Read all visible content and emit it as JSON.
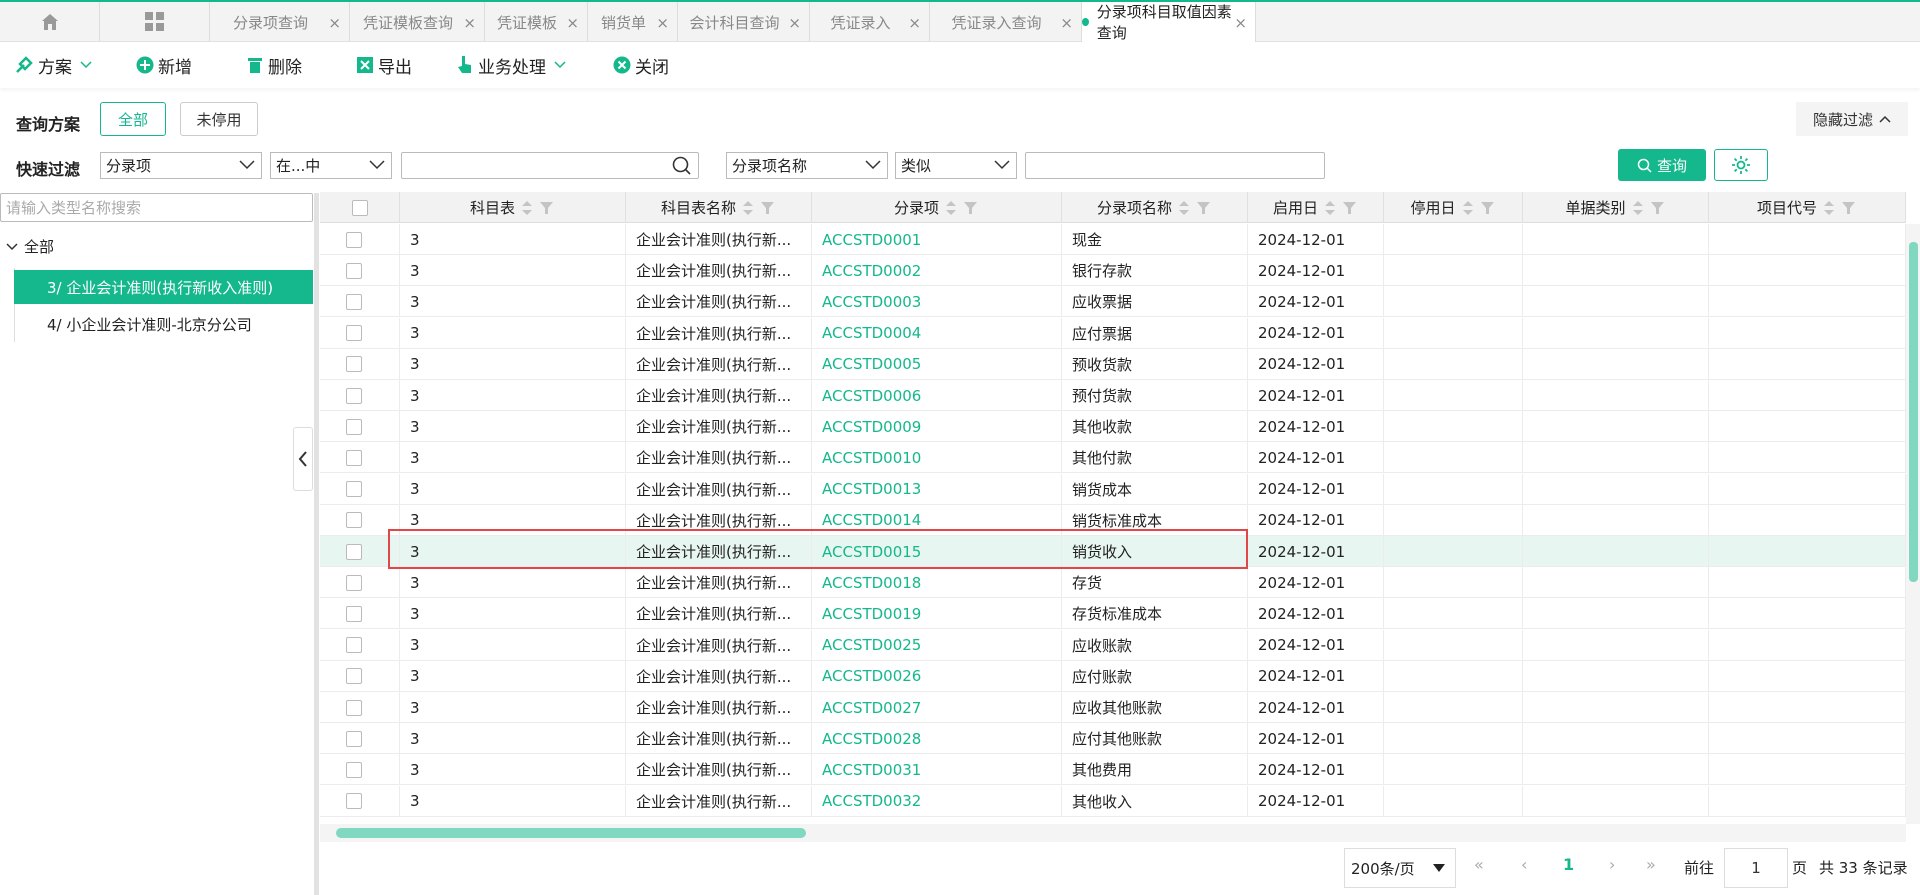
{
  "tabs": {
    "items": [
      {
        "label": "分录项查询"
      },
      {
        "label": "凭证模板查询"
      },
      {
        "label": "凭证模板"
      },
      {
        "label": "销货单"
      },
      {
        "label": "会计科目查询"
      },
      {
        "label": "凭证录入"
      },
      {
        "label": "凭证录入查询"
      },
      {
        "label": "分录项科目取值因素查询",
        "active": true
      }
    ]
  },
  "toolbar": {
    "scheme": "方案",
    "add": "新增",
    "delete": "删除",
    "export": "导出",
    "business": "业务处理",
    "close": "关闭"
  },
  "query": {
    "scheme_label": "查询方案",
    "all": "全部",
    "not_disabled": "未停用",
    "hide_filter": "隐藏过滤",
    "quick_filter_label": "快速过滤",
    "field1": "分录项",
    "op1": "在...中",
    "field2": "分录项名称",
    "op2": "类似",
    "query_button": "查询"
  },
  "tree": {
    "search_placeholder": "请输入类型名称搜索",
    "root": "全部",
    "items": [
      "3/ 企业会计准则(执行新收入准则)",
      "4/ 小企业会计准则-北京分公司"
    ]
  },
  "grid": {
    "columns": [
      "科目表",
      "科目表名称",
      "分录项",
      "分录项名称",
      "启用日",
      "停用日",
      "单据类别",
      "项目代号"
    ],
    "rows": [
      [
        "3",
        "企业会计准则(执行新...",
        "ACCSTD0001",
        "现金",
        "2024-12-01"
      ],
      [
        "3",
        "企业会计准则(执行新...",
        "ACCSTD0002",
        "银行存款",
        "2024-12-01"
      ],
      [
        "3",
        "企业会计准则(执行新...",
        "ACCSTD0003",
        "应收票据",
        "2024-12-01"
      ],
      [
        "3",
        "企业会计准则(执行新...",
        "ACCSTD0004",
        "应付票据",
        "2024-12-01"
      ],
      [
        "3",
        "企业会计准则(执行新...",
        "ACCSTD0005",
        "预收货款",
        "2024-12-01"
      ],
      [
        "3",
        "企业会计准则(执行新...",
        "ACCSTD0006",
        "预付货款",
        "2024-12-01"
      ],
      [
        "3",
        "企业会计准则(执行新...",
        "ACCSTD0009",
        "其他收款",
        "2024-12-01"
      ],
      [
        "3",
        "企业会计准则(执行新...",
        "ACCSTD0010",
        "其他付款",
        "2024-12-01"
      ],
      [
        "3",
        "企业会计准则(执行新...",
        "ACCSTD0013",
        "销货成本",
        "2024-12-01"
      ],
      [
        "3",
        "企业会计准则(执行新...",
        "ACCSTD0014",
        "销货标准成本",
        "2024-12-01"
      ],
      [
        "3",
        "企业会计准则(执行新...",
        "ACCSTD0015",
        "销货收入",
        "2024-12-01"
      ],
      [
        "3",
        "企业会计准则(执行新...",
        "ACCSTD0018",
        "存货",
        "2024-12-01"
      ],
      [
        "3",
        "企业会计准则(执行新...",
        "ACCSTD0019",
        "存货标准成本",
        "2024-12-01"
      ],
      [
        "3",
        "企业会计准则(执行新...",
        "ACCSTD0025",
        "应收账款",
        "2024-12-01"
      ],
      [
        "3",
        "企业会计准则(执行新...",
        "ACCSTD0026",
        "应付账款",
        "2024-12-01"
      ],
      [
        "3",
        "企业会计准则(执行新...",
        "ACCSTD0027",
        "应收其他账款",
        "2024-12-01"
      ],
      [
        "3",
        "企业会计准则(执行新...",
        "ACCSTD0028",
        "应付其他账款",
        "2024-12-01"
      ],
      [
        "3",
        "企业会计准则(执行新...",
        "ACCSTD0031",
        "其他费用",
        "2024-12-01"
      ],
      [
        "3",
        "企业会计准则(执行新...",
        "ACCSTD0032",
        "其他收入",
        "2024-12-01"
      ]
    ],
    "highlighted_row": 10
  },
  "pager": {
    "page_size": "200条/页",
    "current_page": "1",
    "goto_label": "前往",
    "goto_value": "1",
    "page_unit": "页",
    "total": "共 33 条记录"
  },
  "colors": {
    "accent": "#14b88c",
    "highlight_border": "#e04848"
  }
}
